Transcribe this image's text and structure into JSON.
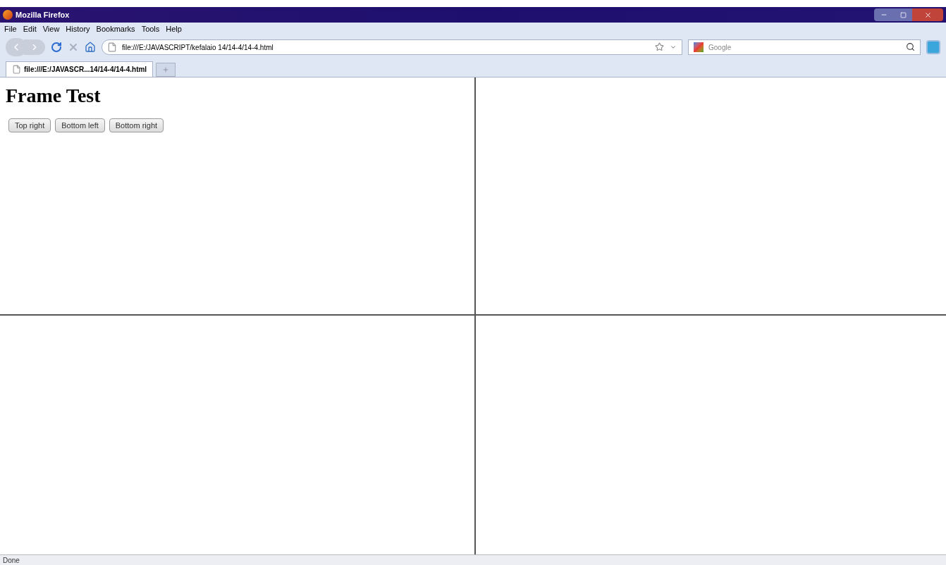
{
  "window": {
    "title": "Mozilla Firefox"
  },
  "menu": [
    "File",
    "Edit",
    "View",
    "History",
    "Bookmarks",
    "Tools",
    "Help"
  ],
  "address": {
    "value": "file:///E:/JAVASCRIPT/kefalaio 14/14-4/14-4.html"
  },
  "search": {
    "placeholder": "Google"
  },
  "tabs": [
    {
      "label": "file:///E:/JAVASCR...14/14-4/14-4.html",
      "selected": true
    }
  ],
  "frames": {
    "heading": "Frame Test",
    "buttons": [
      "Top right",
      "Bottom left",
      "Bottom right"
    ]
  },
  "status_bar": {
    "text": "Done"
  }
}
